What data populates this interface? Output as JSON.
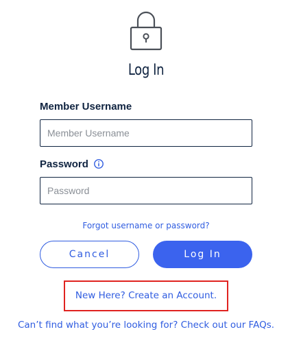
{
  "header": {
    "icon": "lock-icon",
    "title": "Log In"
  },
  "form": {
    "username": {
      "label": "Member Username",
      "placeholder": "Member Username",
      "value": ""
    },
    "password": {
      "label": "Password",
      "info_icon": "info-icon",
      "placeholder": "Password",
      "value": ""
    },
    "forgot_link": "Forgot username or password?",
    "cancel_label": "Cancel",
    "login_label": "Log In"
  },
  "footer": {
    "create_account_link": "New Here? Create an Account.",
    "faq_link": "Can’t find what you’re looking for? Check out our FAQs."
  },
  "colors": {
    "primary": "#3b63ee",
    "link": "#2f5ce0",
    "text": "#0f2340",
    "highlight_border": "#e0221f"
  }
}
